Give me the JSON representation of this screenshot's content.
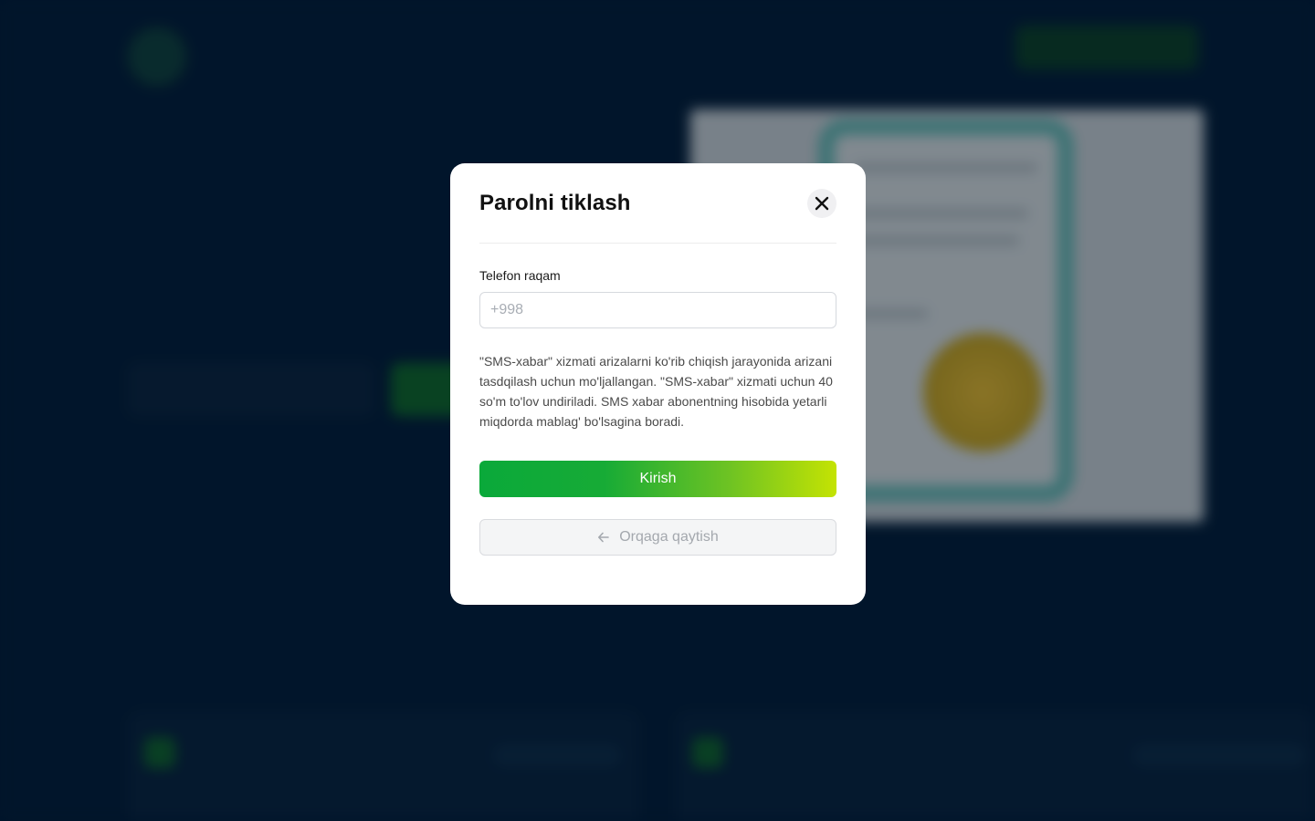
{
  "modal": {
    "title": "Parolni tiklash",
    "close_icon": "close-icon",
    "phone_label": "Telefon raqam",
    "phone_placeholder": "+998",
    "phone_value": "",
    "sms_note": "\"SMS-xabar\" xizmati arizalarni ko'rib chiqish jarayonida arizani tasdqilash uchun mo'ljallangan. \"SMS-xabar\" xizmati uchun 40 so'm to'lov undiriladi. SMS xabar abonentning hisobida yetarli miqdorda mablag' bo'lsagina boradi.",
    "submit_label": "Kirish",
    "back_icon": "arrow-left-icon",
    "back_label": "Orqaga qaytish"
  },
  "colors": {
    "backdrop": "#011832",
    "modal_bg": "#ffffff",
    "submit_gradient_start": "#0aa93a",
    "submit_gradient_end": "#c4e303",
    "secondary_button_bg": "#f4f5f6"
  }
}
